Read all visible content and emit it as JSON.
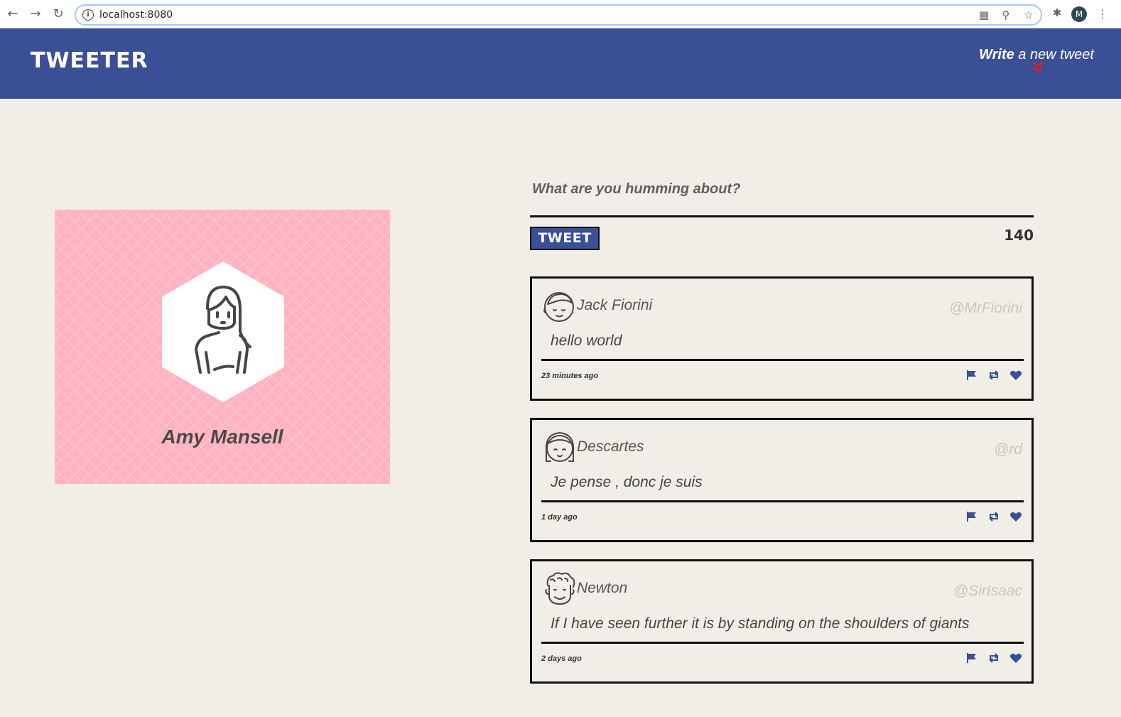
{
  "browser": {
    "url": "localhost:8080",
    "profile_initial": "M"
  },
  "header": {
    "logo": "TWEETER",
    "compose_link_bold": "Write",
    "compose_link_rest": " a new tweet"
  },
  "profile": {
    "name": "Amy Mansell"
  },
  "composer": {
    "prompt": "What are you humming about?",
    "button_label": "TWEET",
    "counter": "140"
  },
  "tweets": [
    {
      "author": "Jack Fiorini",
      "handle": "@MrFiorini",
      "content": "hello world",
      "timestamp": "23 minutes ago"
    },
    {
      "author": "Descartes",
      "handle": "@rd",
      "content": "Je pense , donc je suis",
      "timestamp": "1 day ago"
    },
    {
      "author": "Newton",
      "handle": "@SirIsaac",
      "content": "If I have seen further it is by standing on the shoulders of giants",
      "timestamp": "2 days ago"
    }
  ],
  "icons": {
    "accent": "#3a4f96",
    "header_bg": "#3a4f96",
    "card_bg": "#ffb3c1",
    "arrow_color": "#e02020"
  }
}
